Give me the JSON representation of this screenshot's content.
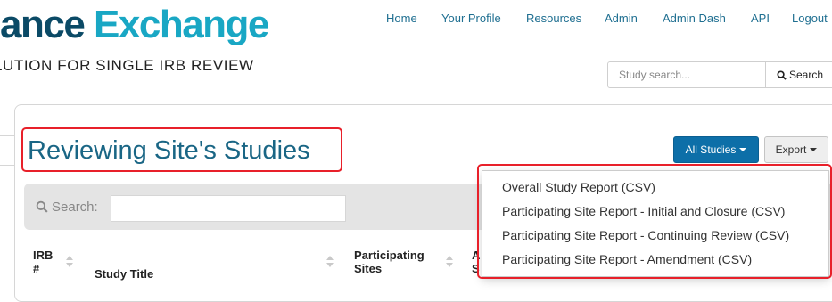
{
  "brand": {
    "name_part1": "ance",
    "name_part2": "Exchange",
    "tagline": "LUTION FOR SINGLE IRB REVIEW"
  },
  "nav": {
    "home": "Home",
    "profile": "Your Profile",
    "resources": "Resources",
    "admin": "Admin",
    "admin_dash": "Admin Dash",
    "api": "API",
    "logout": "Logout"
  },
  "study_search": {
    "placeholder": "Study search...",
    "button_label": "Search"
  },
  "page": {
    "title": "Reviewing Site's Studies"
  },
  "toolbar": {
    "all_studies_label": "All Studies",
    "export_label": "Export"
  },
  "filter": {
    "label": "Search:",
    "value": ""
  },
  "table": {
    "columns": {
      "irb_line1": "IRB",
      "irb_line2": "#",
      "study_title": "Study Title",
      "sites_line1": "Participating",
      "sites_line2": "Sites",
      "next_line1": "A",
      "next_line2": "S"
    }
  },
  "export_menu": {
    "items": [
      "Overall Study Report (CSV)",
      "Participating Site Report - Initial and Closure (CSV)",
      "Participating Site Report - Continuing Review (CSV)",
      "Participating Site Report - Amendment (CSV)"
    ]
  },
  "colors": {
    "brand_dark": "#0b4a66",
    "brand_accent": "#19a7c4",
    "link": "#1f6f91",
    "primary_button": "#0d6fa8",
    "annotation_highlight": "#e8202a"
  }
}
